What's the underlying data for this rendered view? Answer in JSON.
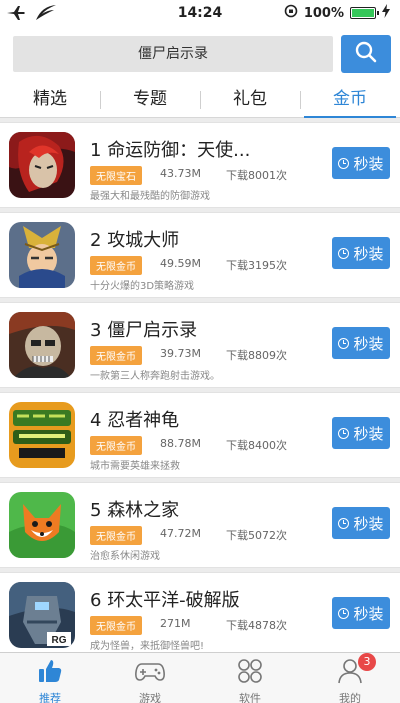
{
  "status_bar": {
    "time": "14:24",
    "battery": "100%"
  },
  "search": {
    "text": "僵尸启示录"
  },
  "tabs": [
    {
      "label": "精选"
    },
    {
      "label": "专题"
    },
    {
      "label": "礼包"
    },
    {
      "label": "金币",
      "active": true
    }
  ],
  "apps": [
    {
      "rank": "1",
      "title": "命运防御：天使...",
      "badge": "无限宝石",
      "size": "43.73M",
      "downloads": "下载8001次",
      "desc": "最强大和最残酷的防御游戏",
      "button": "秒装"
    },
    {
      "rank": "2",
      "title": "攻城大师",
      "badge": "无限金币",
      "size": "49.59M",
      "downloads": "下载3195次",
      "desc": "十分火爆的3D策略游戏",
      "button": "秒装"
    },
    {
      "rank": "3",
      "title": "僵尸启示录",
      "badge": "无限金币",
      "size": "39.73M",
      "downloads": "下载8809次",
      "desc": "一款第三人称奔跑射击游戏。",
      "button": "秒装"
    },
    {
      "rank": "4",
      "title": "忍者神龟",
      "badge": "无限金币",
      "size": "88.78M",
      "downloads": "下载8400次",
      "desc": "城市需要英雄来拯救",
      "button": "秒装"
    },
    {
      "rank": "5",
      "title": "森林之家",
      "badge": "无限金币",
      "size": "47.72M",
      "downloads": "下载5072次",
      "desc": "治愈系休闲游戏",
      "button": "秒装"
    },
    {
      "rank": "6",
      "title": "环太平洋-破解版",
      "badge": "无限金币",
      "size": "271M",
      "downloads": "下载4878次",
      "desc": "成为怪兽，来抵御怪兽吧!",
      "button": "秒装",
      "icon_text": "RG"
    }
  ],
  "bottom_nav": [
    {
      "label": "推荐",
      "icon": "thumbs-up-icon",
      "active": true
    },
    {
      "label": "游戏",
      "icon": "gamepad-icon"
    },
    {
      "label": "软件",
      "icon": "apps-grid-icon"
    },
    {
      "label": "我的",
      "icon": "user-icon",
      "badge": "3"
    }
  ],
  "colors": {
    "accent": "#3c8ddc",
    "badge": "#f4a23e",
    "notification": "#e84848"
  }
}
